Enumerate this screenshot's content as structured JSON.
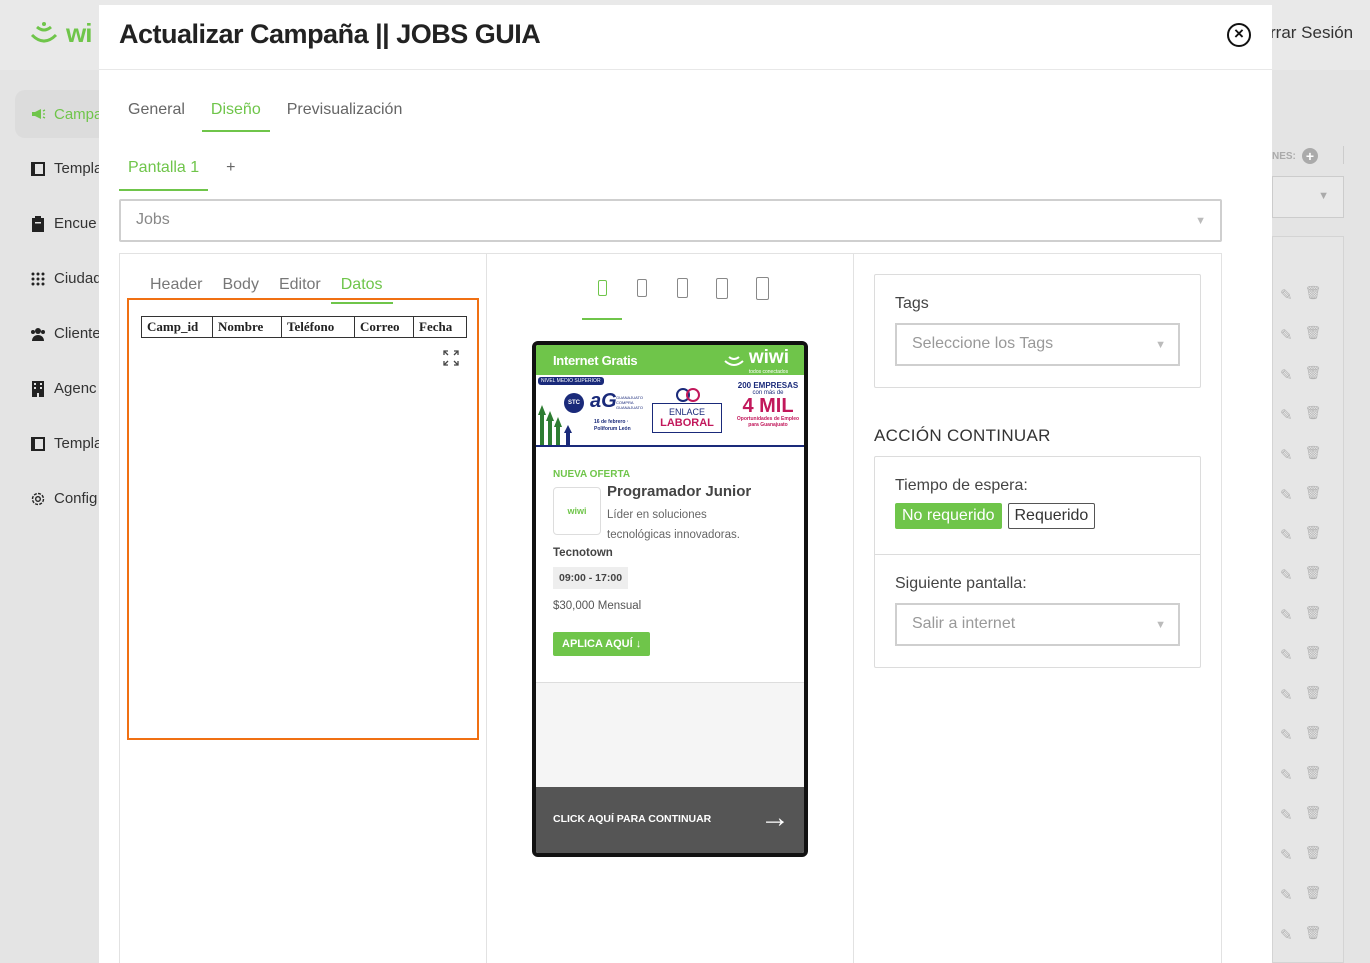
{
  "background": {
    "logo_text": "wi",
    "logout_label": "rrar Sesión",
    "sidebar": [
      {
        "label": "Campa",
        "icon": "megaphone-icon",
        "active": true
      },
      {
        "label": "Templa",
        "icon": "template-icon"
      },
      {
        "label": "Encue",
        "icon": "clipboard-icon"
      },
      {
        "label": "Ciudad",
        "icon": "grid-dots-icon"
      },
      {
        "label": "Cliente",
        "icon": "users-icon"
      },
      {
        "label": "Agenc",
        "icon": "building-icon"
      },
      {
        "label": "Templa",
        "icon": "template-icon"
      },
      {
        "label": "Config",
        "icon": "gear-icon"
      }
    ],
    "right_label": "NES:"
  },
  "modal": {
    "title": "Actualizar Campaña || JOBS GUIA",
    "tabs": [
      "General",
      "Diseño",
      "Previsualización"
    ],
    "active_tab": "Diseño",
    "screen_tabs": [
      "Pantalla 1"
    ],
    "add_screen": "+",
    "template_select": "Jobs"
  },
  "left_panel": {
    "subtabs": [
      "Header",
      "Body",
      "Editor",
      "Datos"
    ],
    "active_subtab": "Datos",
    "table_headers": [
      "Camp_id",
      "Nombre",
      "Teléfono",
      "Correo",
      "Fecha"
    ]
  },
  "preview": {
    "bar_label": "Internet Gratis",
    "brand": "wiwi",
    "brand_sub": "todos conectados",
    "banner": {
      "tag": "NIVEL MEDIO SUPERIOR",
      "stc": "STC",
      "ag": "aG",
      "ag_sub": "GUANAJUATO COMPRA GUANAJUATO",
      "date": "16 de febrero · Poliforum León",
      "enlace_1": "ENLACE",
      "enlace_2": "LABORAL",
      "emp_1": "200 EMPRESAS",
      "emp_2": "con más de",
      "emp_3": "4 MIL",
      "emp_4": "Oportunidades de Empleo para Guanajuato"
    },
    "offer_label": "NUEVA OFERTA",
    "job_logo": "wiwi",
    "job_title": "Programador Junior",
    "job_desc": "Líder en soluciones tecnológicas innovadoras.",
    "company": "Tecnotown",
    "hours": "09:00  -  17:00",
    "salary": "$30,000  Mensual",
    "apply_label": "APLICA AQUÍ",
    "continue_label": "CLICK AQUÍ PARA CONTINUAR"
  },
  "right_panel": {
    "tags_label": "Tags",
    "tags_placeholder": "Seleccione los Tags",
    "section_title": "ACCIÓN CONTINUAR",
    "wait_label": "Tiempo de espera:",
    "wait_options": [
      "No requerido",
      "Requerido"
    ],
    "wait_selected": "No requerido",
    "next_label": "Siguiente pantalla:",
    "next_value": "Salir a internet"
  },
  "colors": {
    "accent": "#6fc54a",
    "highlight": "#f07013"
  }
}
